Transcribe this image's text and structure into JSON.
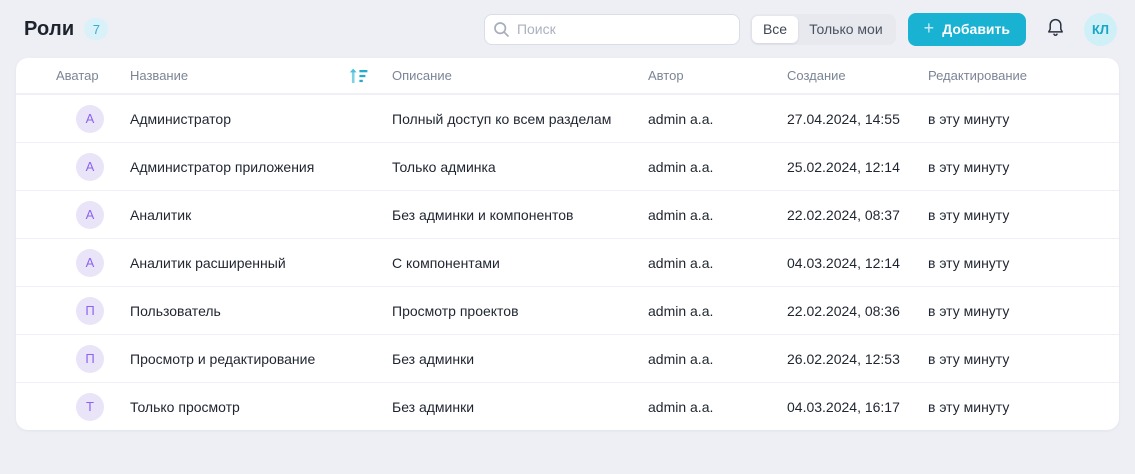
{
  "page": {
    "title": "Роли",
    "count_badge": "7"
  },
  "header": {
    "search": {
      "placeholder": "Поиск",
      "value": ""
    },
    "filter_toggle": {
      "options": [
        {
          "label": "Все",
          "selected": true
        },
        {
          "label": "Только мои",
          "selected": false
        }
      ]
    },
    "add_button": {
      "plus": "+",
      "label": "Добавить"
    },
    "user_avatar_initials": "КЛ"
  },
  "table": {
    "columns": [
      "Аватар",
      "Название",
      "Описание",
      "Автор",
      "Создание",
      "Редактирование"
    ],
    "sorted_by": "Название",
    "sort_direction": "ascending",
    "rows": [
      {
        "avatar_letter": "А",
        "name": "Администратор",
        "description": "Полный доступ ко всем разделам",
        "author": "admin a.a.",
        "created": "27.04.2024, 14:55",
        "edited": "в эту минуту"
      },
      {
        "avatar_letter": "А",
        "name": "Администратор приложения",
        "description": "Только админка",
        "author": "admin a.a.",
        "created": "25.02.2024, 12:14",
        "edited": "в эту минуту"
      },
      {
        "avatar_letter": "А",
        "name": "Аналитик",
        "description": "Без админки и компонентов",
        "author": "admin a.a.",
        "created": "22.02.2024, 08:37",
        "edited": "в эту минуту"
      },
      {
        "avatar_letter": "А",
        "name": "Аналитик расширенный",
        "description": "С компонентами",
        "author": "admin a.a.",
        "created": "04.03.2024, 12:14",
        "edited": "в эту минуту"
      },
      {
        "avatar_letter": "П",
        "name": "Пользователь",
        "description": "Просмотр проектов",
        "author": "admin a.a.",
        "created": "22.02.2024, 08:36",
        "edited": "в эту минуту"
      },
      {
        "avatar_letter": "П",
        "name": "Просмотр и редактирование",
        "description": "Без админки",
        "author": "admin a.a.",
        "created": "26.02.2024, 12:53",
        "edited": "в эту минуту"
      },
      {
        "avatar_letter": "Т",
        "name": "Только просмотр",
        "description": "Без админки",
        "author": "admin a.a.",
        "created": "04.03.2024, 16:17",
        "edited": "в эту минуту"
      }
    ]
  },
  "icons": {
    "search": "search-icon",
    "sort": "sort-ascending-icon",
    "bell": "bell-icon",
    "plus": "plus-icon"
  },
  "colors": {
    "accent_teal": "#19b2d3",
    "badge_bg": "#d9f1f8",
    "badge_text": "#3aaecd",
    "row_avatar_bg": "#eae4f9",
    "row_avatar_text": "#8c63ef",
    "user_avatar_bg": "#cff0f7",
    "user_avatar_text": "#1aa5c7",
    "page_bg": "#edeff5",
    "card_bg": "#ffffff",
    "header_text": "#7c8596",
    "body_text": "#1f2530"
  }
}
